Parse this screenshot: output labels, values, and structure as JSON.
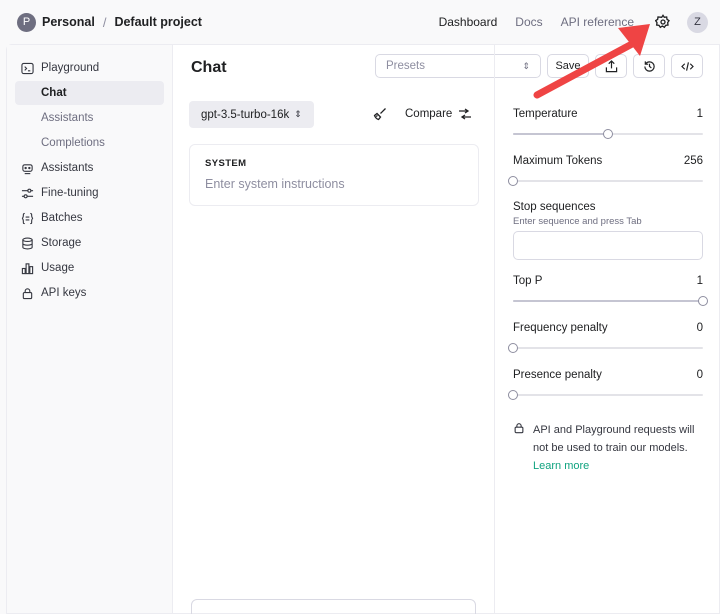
{
  "header": {
    "org_initial": "P",
    "org_name": "Personal",
    "separator": "/",
    "project": "Default project",
    "nav": [
      "Dashboard",
      "Docs",
      "API reference"
    ],
    "user_initial": "Z"
  },
  "sidebar": {
    "items": [
      {
        "label": "Playground",
        "icon": "terminal-icon"
      },
      {
        "label": "Chat"
      },
      {
        "label": "Assistants"
      },
      {
        "label": "Completions"
      },
      {
        "label": "Assistants",
        "icon": "assistant-icon"
      },
      {
        "label": "Fine-tuning",
        "icon": "sliders-icon"
      },
      {
        "label": "Batches",
        "icon": "braces-icon"
      },
      {
        "label": "Storage",
        "icon": "database-icon"
      },
      {
        "label": "Usage",
        "icon": "bar-chart-icon"
      },
      {
        "label": "API keys",
        "icon": "lock-icon"
      }
    ]
  },
  "chat": {
    "title": "Chat",
    "model": "gpt-3.5-turbo-16k",
    "compare": "Compare",
    "system_label": "SYSTEM",
    "system_placeholder": "Enter system instructions"
  },
  "toolbar": {
    "presets_placeholder": "Presets",
    "save": "Save"
  },
  "settings": {
    "temperature": {
      "label": "Temperature",
      "value": "1",
      "fraction": 0.5
    },
    "max_tokens": {
      "label": "Maximum Tokens",
      "value": "256",
      "fraction": 0.0
    },
    "stop": {
      "label": "Stop sequences",
      "hint": "Enter sequence and press Tab"
    },
    "top_p": {
      "label": "Top P",
      "value": "1",
      "fraction": 1.0
    },
    "frequency": {
      "label": "Frequency penalty",
      "value": "0",
      "fraction": 0.0
    },
    "presence": {
      "label": "Presence penalty",
      "value": "0",
      "fraction": 0.0
    },
    "notice": "API and Playground requests will not be used to train our models.",
    "learn_more": "Learn more"
  },
  "annotation": {
    "color": "#ef4444"
  }
}
